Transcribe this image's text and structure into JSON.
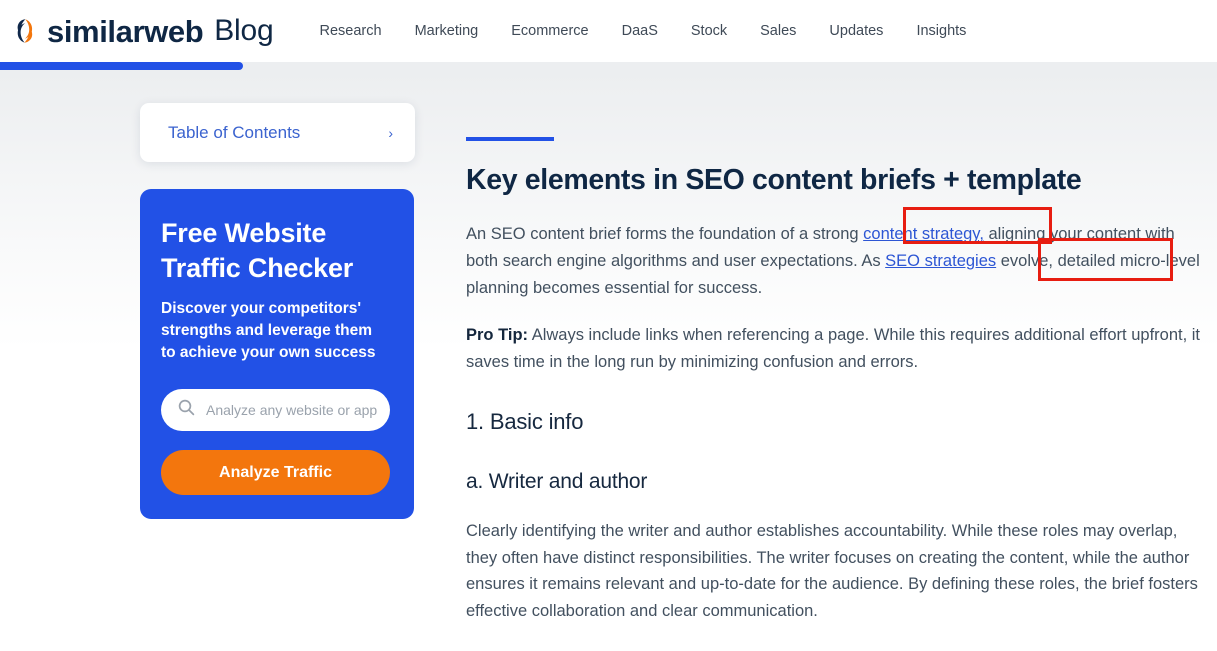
{
  "header": {
    "brand_name": "similarweb",
    "brand_section": "Blog",
    "logo_icon": "similarweb-droplet-logo",
    "nav": [
      {
        "label": "Research"
      },
      {
        "label": "Marketing"
      },
      {
        "label": "Ecommerce"
      },
      {
        "label": "DaaS"
      },
      {
        "label": "Stock"
      },
      {
        "label": "Sales"
      },
      {
        "label": "Updates"
      },
      {
        "label": "Insights"
      }
    ]
  },
  "reading_progress": {
    "percent": 20,
    "fill_color": "#2251e6",
    "track_color": "#eceef0"
  },
  "sidebar": {
    "toc": {
      "label": "Table of Contents",
      "chevron_icon": "chevron-right-icon",
      "chevron_glyph": "›"
    },
    "cta": {
      "title_line_1": "Free Website",
      "title_line_2": "Traffic Checker",
      "subtitle": "Discover your competitors' strengths and leverage them to achieve your own success",
      "search_icon": "search-icon",
      "search_value": "",
      "search_placeholder": "Analyze any website or app",
      "button_label": "Analyze Traffic",
      "background_color": "#2251e6",
      "button_color": "#f3760d"
    }
  },
  "article": {
    "accent_color": "#2251e6",
    "title": "Key elements in SEO content briefs + template",
    "intro": {
      "part_1": "An SEO content brief forms the foundation of a strong ",
      "link_1": "content strategy,",
      "part_2": " aligning your content with both search engine algorithms and user expectations. As ",
      "link_2": "SEO strategies",
      "part_3": " evolve, detailed micro-level planning becomes essential for success."
    },
    "pro_tip": {
      "label": "Pro Tip:",
      "text": " Always include links when referencing a page. While this requires additional effort upfront, it saves time in the long run by minimizing confusion and errors."
    },
    "section_1_heading": "1. Basic info",
    "subsection_a_heading": "a. Writer and author",
    "subsection_a_body": "Clearly identifying the writer and author establishes accountability. While these roles may overlap, they often have distinct responsibilities. The writer focuses on creating the content, while the author ensures it remains relevant and up-to-date for the audience. By defining these roles, the brief fosters effective collaboration and clear communication."
  },
  "annotations": {
    "color": "#e71d11",
    "box_1_target": "content strategy,",
    "box_2_target": "SEO strategies"
  }
}
